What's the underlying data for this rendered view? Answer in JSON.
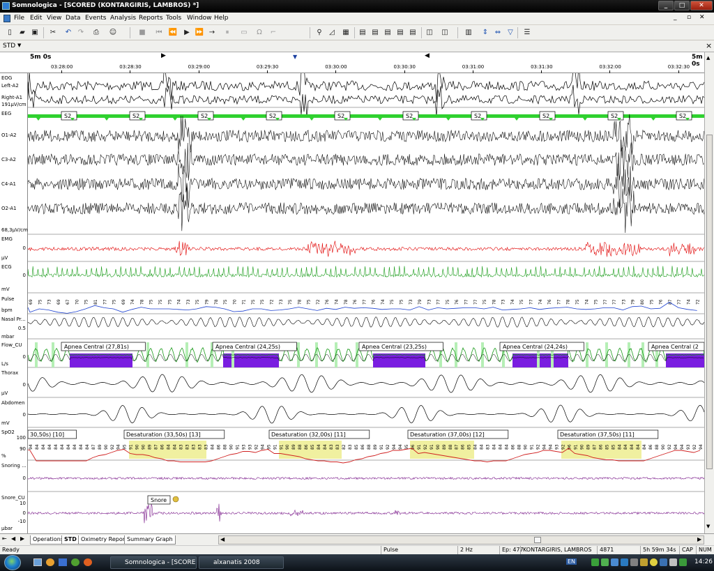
{
  "window": {
    "title": "Somnologica - [SCORED (KONTARGIRIS, LAMBROS) *]",
    "controls": [
      "_",
      "□",
      "✕"
    ],
    "doc_controls": [
      "_",
      "▫",
      "✕"
    ]
  },
  "menu": [
    "File",
    "Edit",
    "View",
    "Data",
    "Events",
    "Analysis",
    "Reports",
    "Tools",
    "Window",
    "Help"
  ],
  "toolbar": {
    "icons": [
      "new-file-icon",
      "open-folder-icon",
      "save-icon",
      "undo-icon",
      "redo-icon",
      "print-icon",
      "patient-icon",
      "stop-icon",
      "skip-start-icon",
      "skip-back-icon",
      "play-icon",
      "fast-forward-icon",
      "step-forward-icon",
      "pause-icon",
      "record-icon",
      "omega-icon",
      "marker-icon",
      "zoom-icon",
      "measure-icon",
      "window1-icon",
      "window2-icon",
      "window3-icon",
      "window4-icon",
      "window5-icon",
      "panel1-icon",
      "panel2-icon",
      "layout-icon",
      "expand-icon",
      "compress-icon",
      "filter-icon",
      "settings-icon"
    ]
  },
  "view_selector": {
    "value": "STD",
    "close": "×"
  },
  "ruler": {
    "left_span": "5m 0s",
    "right_span": "5m 0s",
    "times": [
      "03:28:00",
      "03:28:30",
      "03:29:00",
      "03:29:30",
      "03:30:00",
      "03:30:30",
      "03:31:00",
      "03:31:30",
      "03:32:00",
      "03:32:30"
    ]
  },
  "channels": {
    "eog": {
      "name": "EOG",
      "left": "Left-A2",
      "right": "Right-A1",
      "scale": "191μV/cm"
    },
    "eeg": {
      "name": "EEG",
      "leads": [
        "O1-A2",
        "C3-A2",
        "C4-A1",
        "O2-A1"
      ],
      "scale": "68,3μV/cm"
    },
    "emg": {
      "name": "EMG",
      "zero": "0",
      "unit": "μV"
    },
    "ecg": {
      "name": "ECG",
      "zero": "0",
      "unit": "mV"
    },
    "pulse": {
      "name": "Pulse",
      "unit": "bpm",
      "values": [
        "69",
        "75",
        "73",
        "69",
        "67",
        "70",
        "75",
        "81",
        "77",
        "75",
        "69",
        "74",
        "78",
        "75",
        "75",
        "75",
        "74",
        "73",
        "75",
        "79",
        "78",
        "75",
        "70",
        "71",
        "75",
        "75",
        "72",
        "73",
        "75",
        "78",
        "75",
        "72",
        "76",
        "74",
        "78",
        "76",
        "77",
        "76",
        "74",
        "75",
        "75",
        "73",
        "79",
        "73",
        "77",
        "75",
        "76",
        "77",
        "77",
        "75",
        "78",
        "73",
        "74",
        "75",
        "77",
        "74",
        "76",
        "77",
        "78",
        "75",
        "74",
        "75",
        "77",
        "77",
        "73",
        "79",
        "80",
        "75",
        "76",
        "87",
        "77",
        "74",
        "72"
      ]
    },
    "nasal": {
      "name": "Nasal Pr...",
      "tick": "0.5",
      "unit": "mbar"
    },
    "flow": {
      "name": "Flow_CU",
      "zero": "0",
      "unit": "L/s",
      "events": [
        "Apnea Central (27,81s)",
        "Apnea Central (24,25s)",
        "Apnea Central (23,25s)",
        "Apnea Central (24,24s)",
        "Apnea Central (2"
      ]
    },
    "thorax": {
      "name": "Thorax",
      "zero": "0",
      "unit": "μV"
    },
    "abdomen": {
      "name": "Abdomen",
      "zero": "0",
      "unit": "mV"
    },
    "spo2": {
      "name": "SpO2",
      "top": "100",
      "mid": "90",
      "unit": "%",
      "events": [
        "30,50s) [10]",
        "Desaturation (33,50s) [13]",
        "Desaturation (32,00s) [11]",
        "Desaturation (37,00s) [12]",
        "Desaturation (37,50s) [11]"
      ],
      "values": [
        "94",
        "84",
        "84",
        "84",
        "84",
        "84",
        "84",
        "84",
        "84",
        "84",
        "87",
        "89",
        "90",
        "92",
        "94",
        "95",
        "91",
        "90",
        "90",
        "89",
        "87",
        "86",
        "84",
        "84",
        "83",
        "83",
        "83",
        "83",
        "83",
        "84",
        "86",
        "88",
        "90",
        "91",
        "93",
        "93",
        "92",
        "94",
        "95",
        "91",
        "91",
        "90",
        "89",
        "88",
        "86",
        "85",
        "84",
        "84",
        "83",
        "83",
        "82",
        "83",
        "85",
        "86",
        "88",
        "89",
        "91",
        "92",
        "94",
        "94",
        "95",
        "96",
        "91",
        "92",
        "91",
        "90",
        "89",
        "88",
        "87",
        "86",
        "85",
        "84",
        "84",
        "83",
        "84",
        "84",
        "84",
        "86",
        "88",
        "90",
        "91",
        "92",
        "94",
        "94",
        "93",
        "92",
        "96",
        "91",
        "90",
        "89",
        "87",
        "86",
        "85",
        "85",
        "84",
        "84",
        "84",
        "84",
        "84",
        "86",
        "88",
        "90",
        "92",
        "94",
        "94",
        "93",
        "92",
        "94"
      ]
    },
    "snoring": {
      "name": "Snoring ...",
      "zero": "0"
    },
    "snore_cu": {
      "name": "Snore_CU",
      "ticks": [
        "10",
        "0",
        "-10"
      ],
      "unit": "μbar",
      "event": "Snore"
    }
  },
  "stage_label": "S2",
  "tabs": [
    "Operations",
    "STD",
    "Oximetry Report",
    "Summary Graph"
  ],
  "status": {
    "ready": "Ready",
    "channel": "Pulse",
    "rate": "2 Hz",
    "epoch": "Ep: 477",
    "patient": "KONTARGIRIS, LAMBROS",
    "id": "4871",
    "duration": "5h 59m 34s",
    "cap": "CAP",
    "num": "NUM"
  },
  "taskbar": {
    "tasks": [
      "Somnologica - [SCORE...",
      "alxanatis 2008"
    ],
    "lang": "EN",
    "clock": "14:26"
  },
  "colors": {
    "stage": "#2fd12f",
    "emg": "#e00000",
    "ecg": "#159a15",
    "pulse": "#1a3fd0",
    "apnea": "#7a1de0",
    "flow": "#1a9a1a",
    "spo2": "#d02020",
    "desat": "#f0f0a0",
    "snore": "#7a1a8a"
  }
}
